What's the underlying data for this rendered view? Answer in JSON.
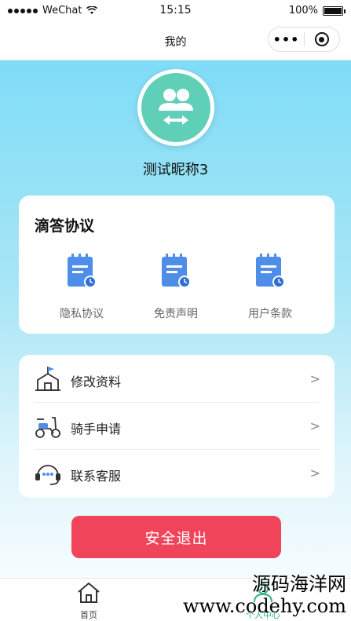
{
  "status_bar": {
    "carrier": "WeChat",
    "time": "15:15",
    "battery": "100%"
  },
  "navbar": {
    "title": "我的",
    "more": "•••"
  },
  "profile": {
    "nickname": "测试昵称3"
  },
  "protocols": {
    "title": "滴答协议",
    "items": [
      {
        "label": "隐私协议",
        "icon": "document-calendar-icon"
      },
      {
        "label": "免责声明",
        "icon": "document-calendar-icon"
      },
      {
        "label": "用户条款",
        "icon": "document-calendar-icon"
      }
    ]
  },
  "menu": {
    "items": [
      {
        "label": "修改资料",
        "icon": "house-flag-icon",
        "arrow": ">"
      },
      {
        "label": "骑手申请",
        "icon": "scooter-icon",
        "arrow": ">"
      },
      {
        "label": "联系客服",
        "icon": "headset-icon",
        "arrow": ">"
      }
    ]
  },
  "logout": {
    "label": "安全退出"
  },
  "tabbar": {
    "items": [
      {
        "label": "首页",
        "icon": "home-icon"
      },
      {
        "label": "个人中心",
        "icon": "user-icon"
      }
    ]
  },
  "watermark": {
    "line1": "源码海洋网",
    "line2": "www.codehy.com"
  },
  "colors": {
    "accent": "#f0445a",
    "avatar": "#5fcfb8",
    "icon_blue": "#4e8ee8",
    "tab_active": "#38b48b"
  }
}
